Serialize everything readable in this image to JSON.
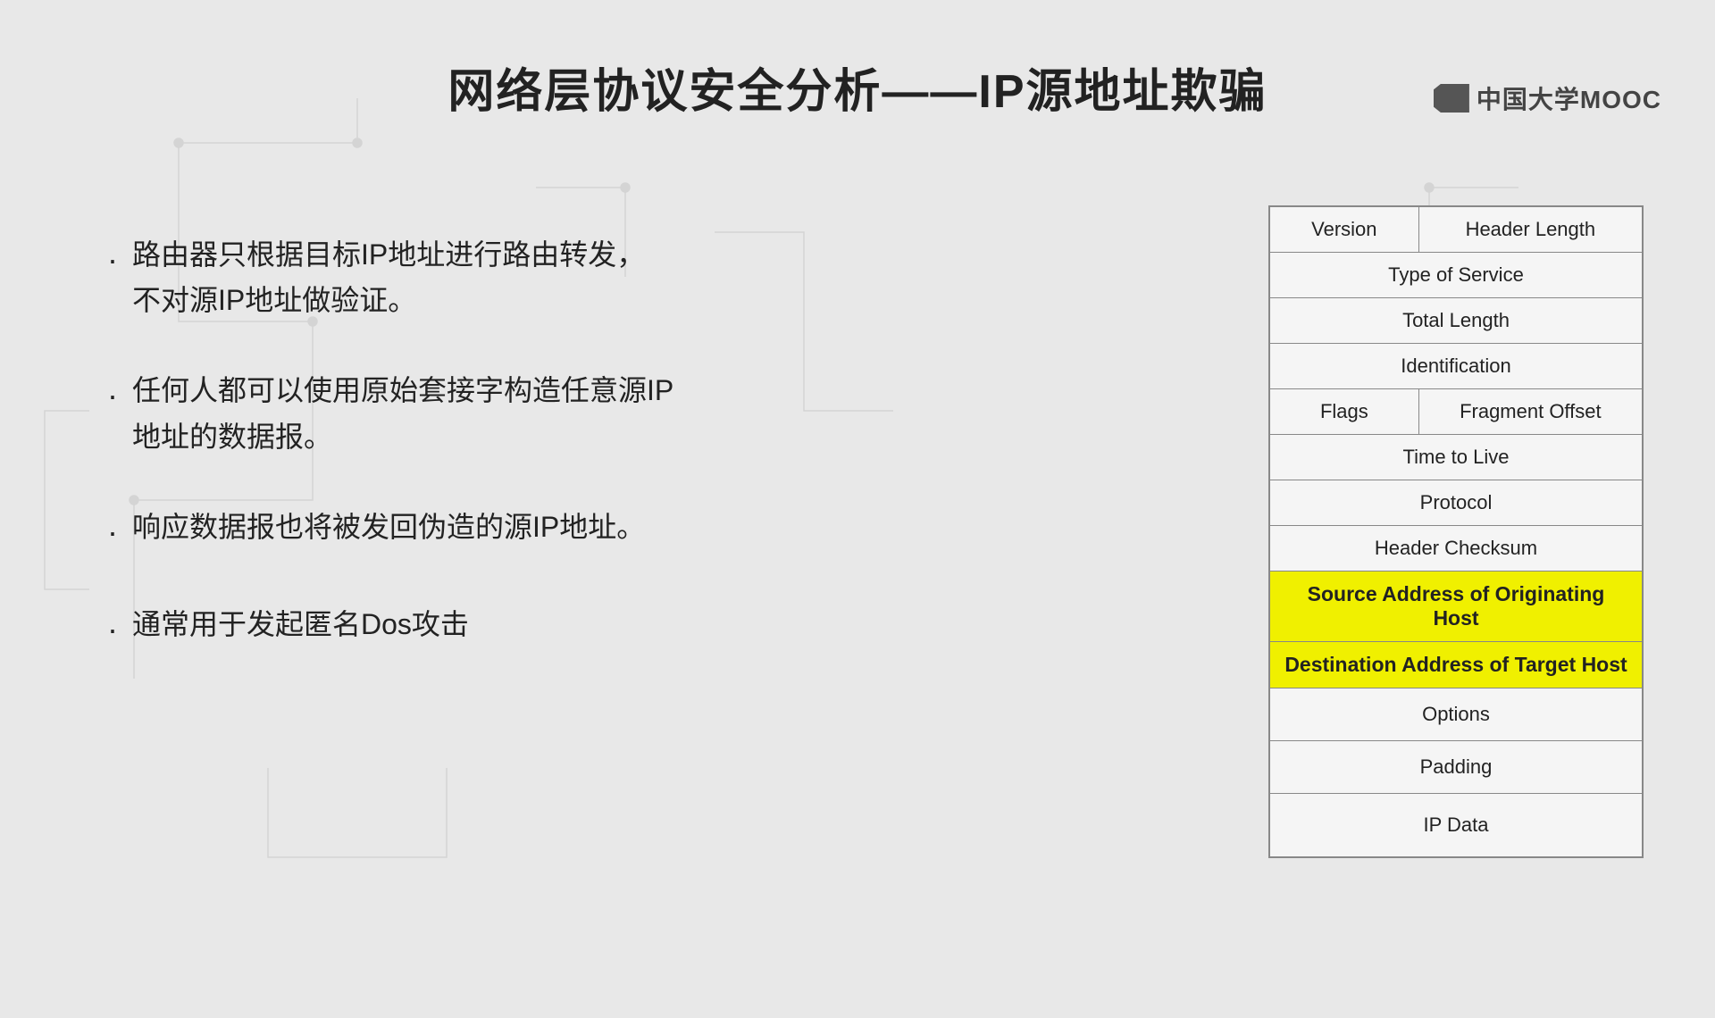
{
  "logo": {
    "text": "中国大学MOOC"
  },
  "title": "网络层协议安全分析——IP源地址欺骗",
  "bullets": [
    {
      "text": "路由器只根据目标IP地址进行路由转发，\n不对源IP地址做验证。"
    },
    {
      "text": "任何人都可以使用原始套接字构造任意源IP\n地址的数据报。"
    },
    {
      "text": "响应数据报也将被发回伪造的源IP地址。"
    },
    {
      "text": "通常用于发起匿名Dos攻击"
    }
  ],
  "table": {
    "rows": [
      {
        "type": "split",
        "left": "Version",
        "right": "Header Length"
      },
      {
        "type": "full",
        "text": "Type of Service"
      },
      {
        "type": "full",
        "text": "Total Length"
      },
      {
        "type": "full",
        "text": "Identification"
      },
      {
        "type": "split",
        "left": "Flags",
        "right": "Fragment Offset"
      },
      {
        "type": "full",
        "text": "Time to Live"
      },
      {
        "type": "full",
        "text": "Protocol"
      },
      {
        "type": "full",
        "text": "Header Checksum"
      },
      {
        "type": "full",
        "text": "Source Address of Originating Host",
        "highlight": true
      },
      {
        "type": "full",
        "text": "Destination Address of Target Host",
        "highlight": true
      },
      {
        "type": "full",
        "text": "Options"
      },
      {
        "type": "full",
        "text": "Padding"
      },
      {
        "type": "full",
        "text": "IP Data",
        "tall": true
      }
    ]
  }
}
